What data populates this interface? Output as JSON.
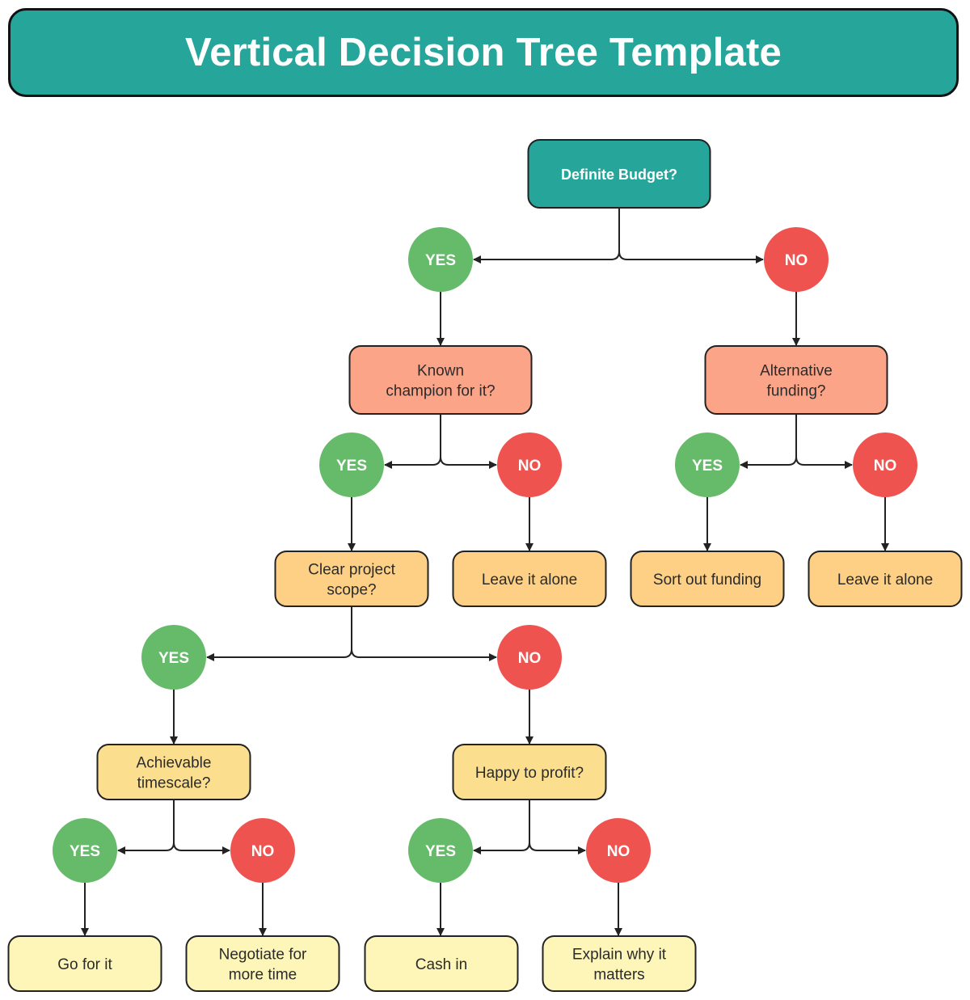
{
  "title": "Vertical Decision Tree Template",
  "colors": {
    "root": "#26A69A",
    "level2": "#FCA487",
    "level3": "#FDD085",
    "level4": "#FBDF8F",
    "leaf": "#FEF6B9",
    "yes": "#66BB6A",
    "no": "#EF5350",
    "stroke": "#222222"
  },
  "nodes": {
    "root": {
      "label": [
        "Definite Budget?"
      ]
    },
    "known_champion": {
      "label": [
        "Known",
        "champion for it?"
      ]
    },
    "alternative_funding": {
      "label": [
        "Alternative",
        "funding?"
      ]
    },
    "clear_scope": {
      "label": [
        "Clear project",
        "scope?"
      ]
    },
    "leave_alone_1": {
      "label": [
        "Leave it alone"
      ]
    },
    "sort_funding": {
      "label": [
        "Sort out funding"
      ]
    },
    "leave_alone_2": {
      "label": [
        "Leave it alone"
      ]
    },
    "achievable_timescale": {
      "label": [
        "Achievable",
        "timescale?"
      ]
    },
    "happy_to_profit": {
      "label": [
        "Happy to profit?"
      ]
    },
    "go_for_it": {
      "label": [
        "Go for it"
      ]
    },
    "negotiate_time": {
      "label": [
        "Negotiate for",
        "more time"
      ]
    },
    "cash_in": {
      "label": [
        "Cash in"
      ]
    },
    "explain_why": {
      "label": [
        "Explain why it",
        "matters"
      ]
    }
  },
  "answers": {
    "yes": "YES",
    "no": "NO"
  }
}
